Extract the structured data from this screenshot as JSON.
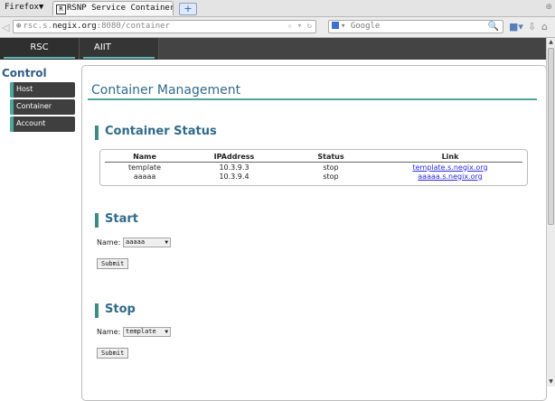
{
  "browser": {
    "menu_label": "Firefox▼",
    "tab_favicon": "R",
    "tab_title": "RSNP Service Container",
    "new_tab_label": "+",
    "url_prefix": "rsc.s.",
    "url_domain": "negix.org",
    "url_rest": ":8080/container",
    "search_placeholder": "Google",
    "icons": [
      "back-icon",
      "site-identity-icon",
      "bookmark-star-icon",
      "reload-icon",
      "search-engine-icon",
      "search-icon",
      "addon-icon",
      "download-icon",
      "home-icon"
    ]
  },
  "sitenav": {
    "tabs": [
      {
        "label": "RSC"
      },
      {
        "label": "AIIT"
      }
    ]
  },
  "sidebar": {
    "title": "Control",
    "items": [
      {
        "label": "Host"
      },
      {
        "label": "Container"
      },
      {
        "label": "Account"
      }
    ]
  },
  "main": {
    "title": "Container Management",
    "status": {
      "title": "Container Status",
      "columns": [
        "Name",
        "IPAddress",
        "Status",
        "Link"
      ],
      "rows": [
        {
          "name": "template",
          "ip": "10.3.9.3",
          "status": "stop",
          "link": "template.s.negix.org"
        },
        {
          "name": "aaaaa",
          "ip": "10.3.9.4",
          "status": "stop",
          "link": "aaaaa.s.negix.org"
        }
      ]
    },
    "start": {
      "title": "Start",
      "name_label": "Name:",
      "selected": "aaaaa",
      "submit_label": "Submit"
    },
    "stop": {
      "title": "Stop",
      "name_label": "Name:",
      "selected": "template",
      "submit_label": "Submit"
    }
  },
  "colors": {
    "accent": "#4fa7a0",
    "heading": "#2f6b8a",
    "nav_bg": "#444444",
    "sidebar_item_bg": "#3f3f3f",
    "link": "#2a2ae0"
  }
}
